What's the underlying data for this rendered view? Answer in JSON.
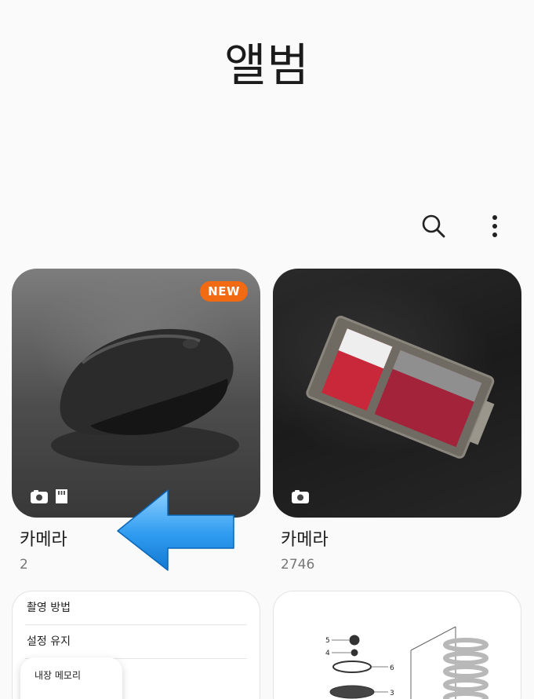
{
  "page": {
    "title": "앨범"
  },
  "toolbar": {
    "search_icon": "search-icon",
    "more_icon": "more-vertical-icon"
  },
  "albums": [
    {
      "name": "카메라",
      "count": "2",
      "badge": "NEW",
      "icons": [
        "camera-icon",
        "sd-card-icon"
      ]
    },
    {
      "name": "카메라",
      "count": "2746",
      "icons": [
        "camera-icon"
      ]
    }
  ],
  "settings_card": {
    "items": [
      "촬영 방법",
      "설정 유지"
    ],
    "popup_label": "내장 메모리"
  },
  "colors": {
    "badge": "#f26a12",
    "arrow": "#2f9cf0"
  }
}
